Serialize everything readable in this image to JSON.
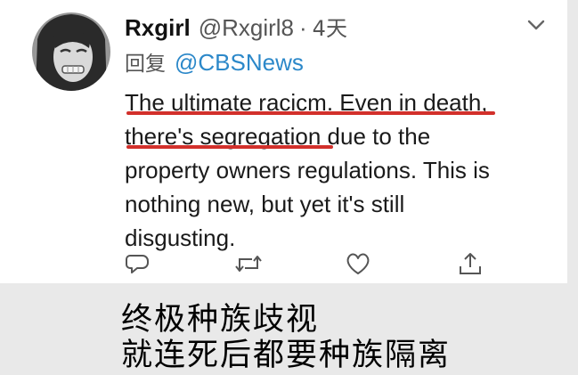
{
  "tweet": {
    "display_name": "Rxgirl",
    "handle": "@Rxgirl8",
    "separator": "·",
    "time_ago": "4天",
    "reply_label": "回复",
    "reply_to": "@CBSNews",
    "text_lines": [
      "The ultimate racicm. Even in death,",
      "there's segregation due to the",
      "property owners regulations. This is",
      "nothing new, but yet it's still",
      "disgusting."
    ]
  },
  "actions": {
    "icons": [
      "reply-icon",
      "retweet-icon",
      "like-icon",
      "share-icon"
    ]
  },
  "caption": {
    "line1": "终极种族歧视",
    "line2": "就连死后都要种族隔离"
  },
  "colors": {
    "background": "#e9e9e9",
    "card": "#ffffff",
    "mention": "#2c88c9",
    "underline": "#d2302b",
    "icon": "#555555"
  }
}
